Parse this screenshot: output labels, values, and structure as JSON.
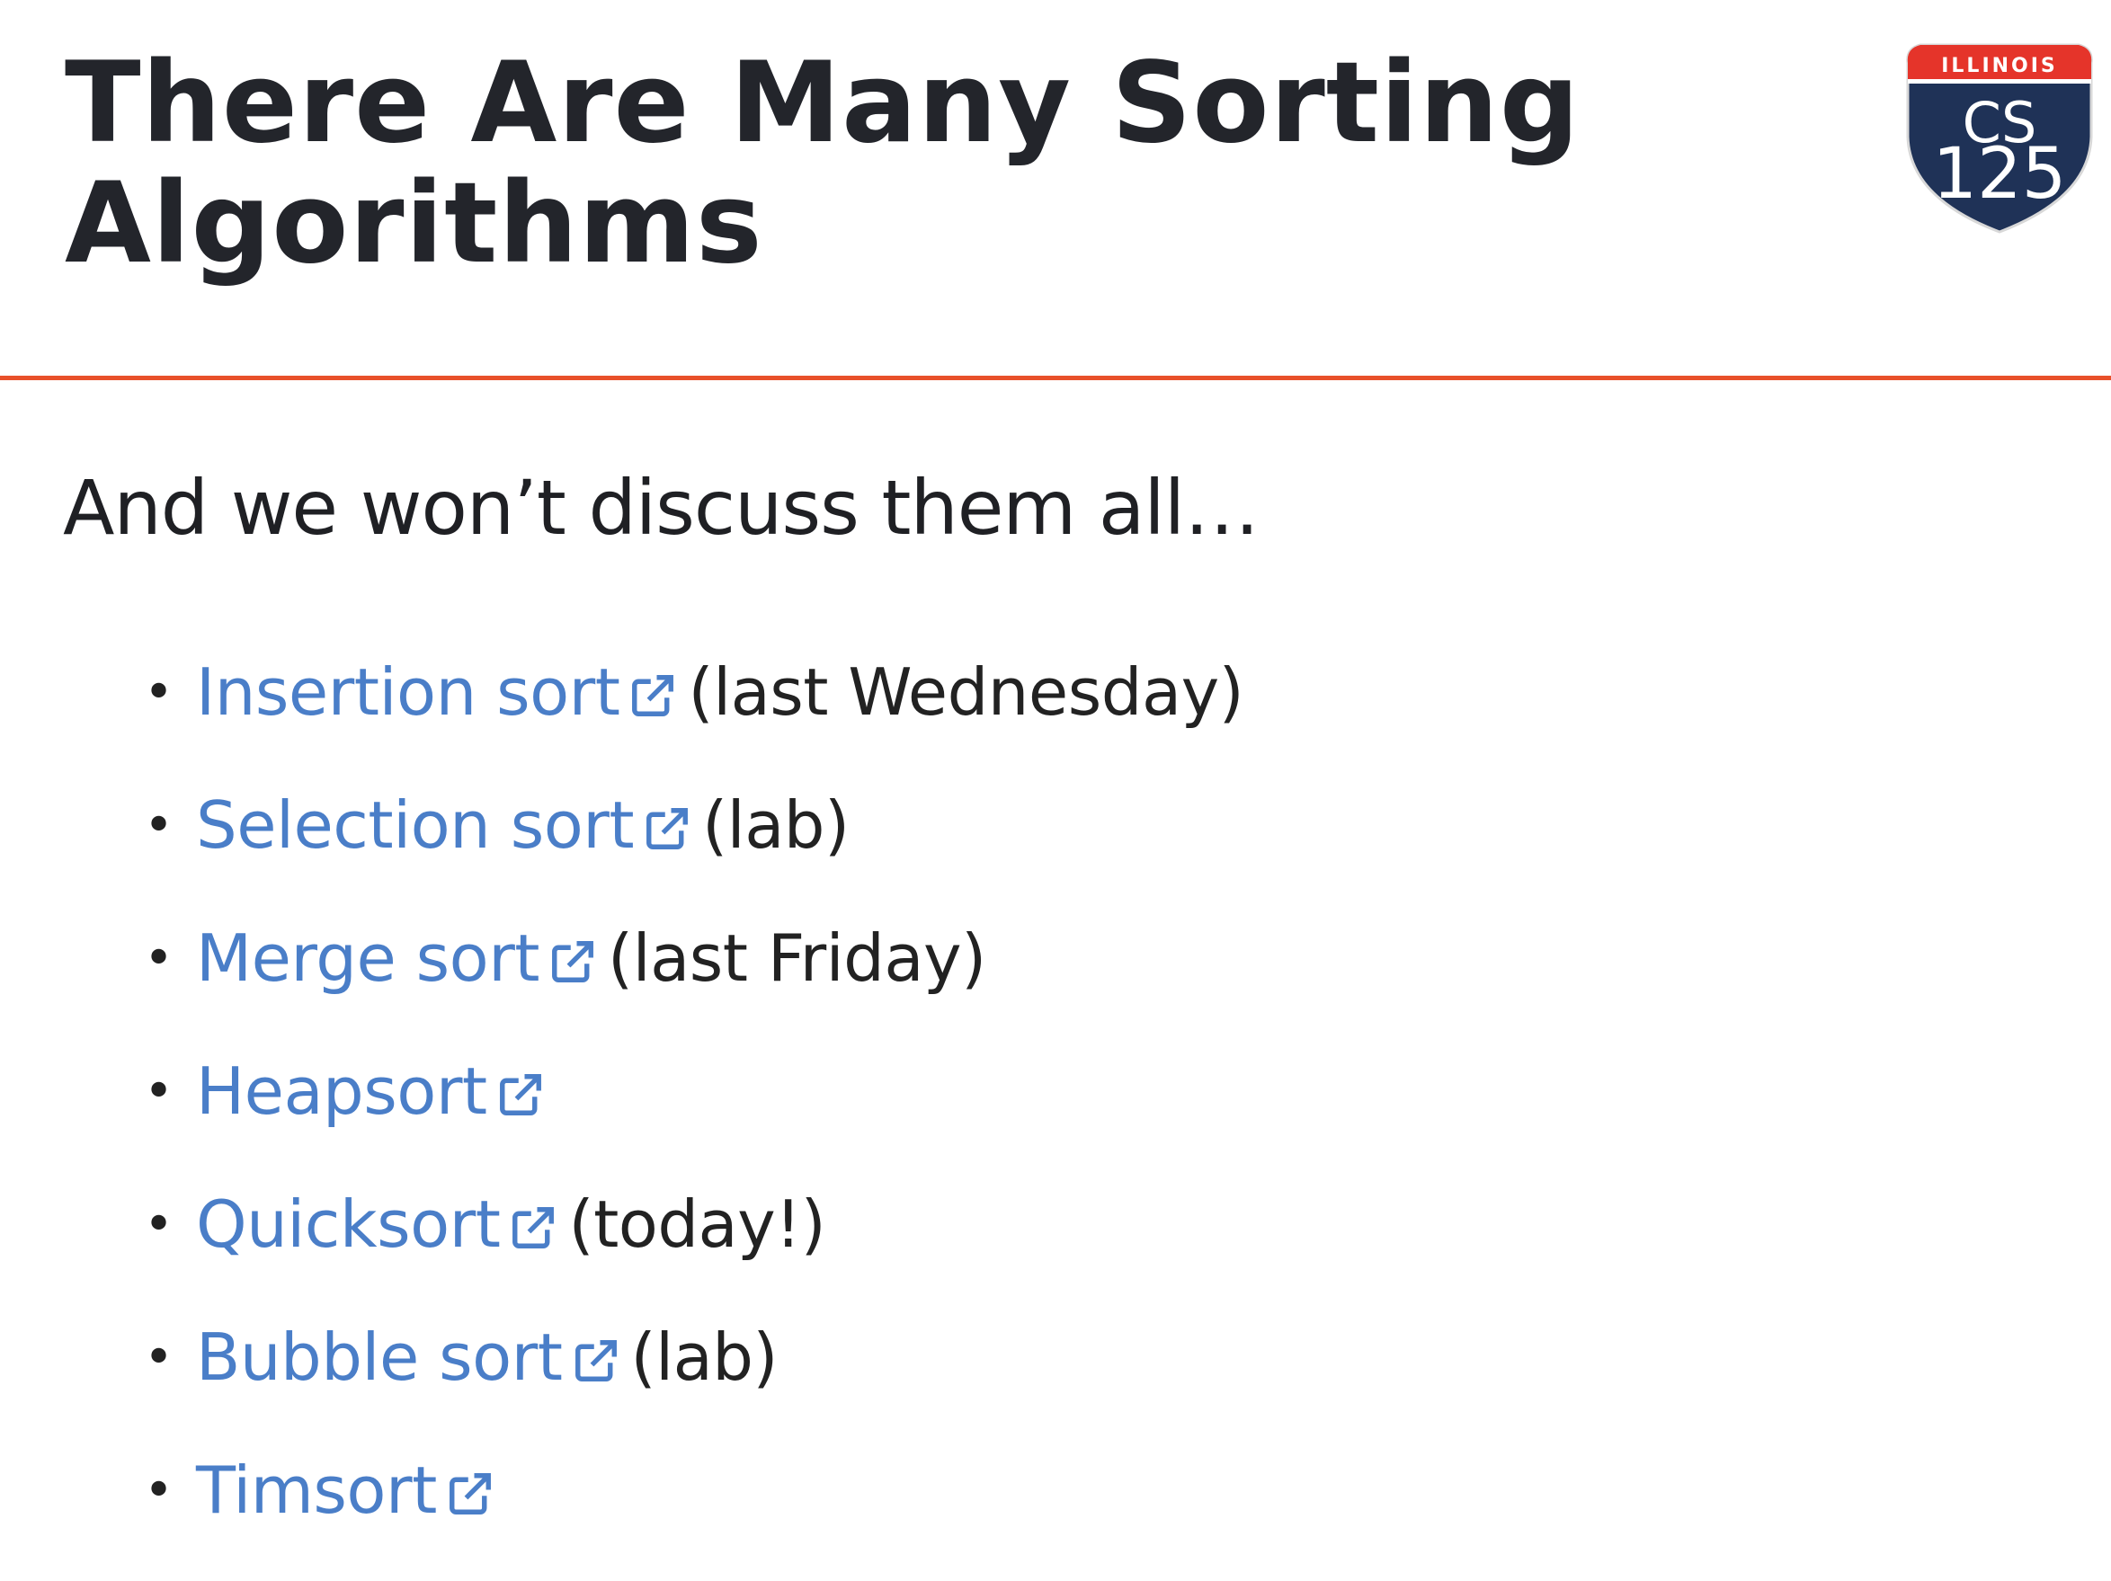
{
  "slide": {
    "title": "There Are Many Sorting Algorithms",
    "subtitle": "And we won’t discuss them all…",
    "accent_color": "#e8502a",
    "link_color": "#4a7ec8"
  },
  "logo": {
    "banner_text": "ILLINOIS",
    "line1": "CS",
    "line2": "125",
    "banner_color": "#e5342a",
    "shield_color": "#1f3257"
  },
  "items": [
    {
      "link": "Insertion sort",
      "note": "(last Wednesday)",
      "icon": "external-link-icon"
    },
    {
      "link": "Selection sort",
      "note": "(lab)",
      "icon": "external-link-icon"
    },
    {
      "link": "Merge sort",
      "note": "(last Friday)",
      "icon": "external-link-icon"
    },
    {
      "link": "Heapsort",
      "note": "",
      "icon": "external-link-icon"
    },
    {
      "link": "Quicksort",
      "note": "(today!)",
      "icon": "external-link-icon"
    },
    {
      "link": "Bubble sort",
      "note": "(lab)",
      "icon": "external-link-icon"
    },
    {
      "link": "Timsort",
      "note": "",
      "icon": "external-link-icon"
    }
  ]
}
